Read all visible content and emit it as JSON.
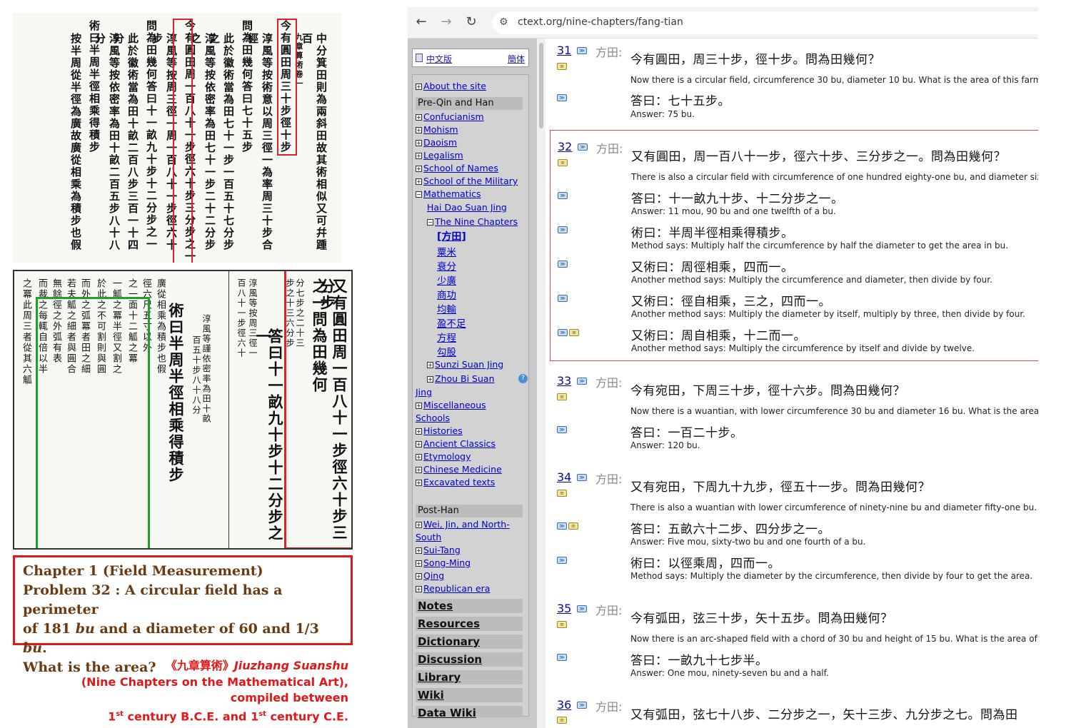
{
  "scan": {
    "top_columns": [
      "中分箕田則為兩斜田故其術相似又可幷踵百",
      "九章算術卷一",
      "今有圓田周三十步徑十步",
      "淳風等按術意以周三徑一為率周三十步合徑",
      "問為田幾何答曰七十五步",
      "此於徽術當為田七十一步一百五十七分步之",
      "淳風等按依密率為田七十一步二十二分步之",
      "今有圓田周一百八十一步徑六十步三分步之一",
      "淳風等按周三徑一周一百八十一步徑六十步",
      "問為田幾何答曰十一畝九十步十二分步之一",
      "此於徽術當為田十畝二百八步三百一十四分",
      "淳風等按依密率為田十畝二百五步八十八分",
      "術曰半周半徑相乘得積步",
      "按半周從半徑為廣故廣從相乘為積步也假"
    ],
    "bottom_columns_right": [
      "又有圓田周一百八十一步徑六十步三分步",
      "之一問為田幾何",
      "答曰十一畝九十步十二分步之一",
      "分七步之二十三",
      "步之十三六分步",
      "淳風等按周三徑一",
      "百八十一步徑六十"
    ],
    "bottom_columns_left": [
      "術曰半周半徑相乘得積步",
      "淳風等謹依密率為田十畝",
      "百五十步八十八分",
      "廣從相乘為積步也假",
      "徑六尺五寸以外",
      "之一面十二觚之冪",
      "一觚之冪半徑又割之",
      "於此之不可割則與圓",
      "而外之弧冪者田之細",
      "若夫觚之細者與圓合",
      "無餘徑之外弧有表",
      "而裁之每輒自倍以半",
      "之冪此周三者從其六觚"
    ],
    "problem_box": {
      "line1": "Chapter 1 (Field Measurement)",
      "line2": "Problem 32 : A circular field has a perimeter",
      "line3a": "of 181 ",
      "line3_unit1": "bu",
      "line3b": " and a diameter of 60 and 1/3 ",
      "line3_unit2": "bu",
      "line3c": ".",
      "line4": "What is the area?"
    },
    "credit": {
      "line1a": "《九章算術》",
      "line1b": "Jiuzhang Suanshu",
      "line2": "(Nine Chapters on the Mathematical Art),",
      "line3": "compiled between",
      "line4a": "1",
      "line4_sup1": "st",
      "line4b": " century B.C.E. and 1",
      "line4_sup2": "st",
      "line4c": " century C.E."
    },
    "colors": {
      "red": "#e01818",
      "green": "#1ea02a",
      "problem_text": "#6b3a10"
    }
  },
  "browser": {
    "back_icon": "←",
    "forward_icon": "→",
    "reload_icon": "↻",
    "url": "ctext.org/nine-chapters/fang-tian",
    "sidebar": {
      "lang_zh": "中文版",
      "lang_simplified": "簡体",
      "about": "About the site",
      "preqin_header": "Pre-Qin and Han",
      "confucianism": "Confucianism",
      "mohism": "Mohism",
      "daoism": "Daoism",
      "legalism": "Legalism",
      "names": "School of Names",
      "military": "School of the Military",
      "mathematics": "Mathematics",
      "haidao": "Hai Dao Suan Jing",
      "nine_chapters": "The Nine Chapters",
      "fangtian": "[方田]",
      "sumi": "粟米",
      "cuifen": "衰分",
      "shaoguang": "少廣",
      "shanggong": "商功",
      "junshu": "均輸",
      "yingbuzu": "盈不足",
      "fangcheng": "方程",
      "gougu": "勾股",
      "sunzi": "Sunzi Suan Jing",
      "zhoubi_a": "Zhou Bi Suan",
      "zhoubi_b": "Jing",
      "misc_a": "Miscellaneous",
      "misc_b": "Schools",
      "histories": "Histories",
      "ancient": "Ancient Classics",
      "etymology": "Etymology",
      "medicine": "Chinese Medicine",
      "excavated": "Excavated texts",
      "posthan_header": "Post-Han",
      "wei_a": "Wei, Jin, and North-",
      "wei_b": "South",
      "suitang": "Sui-Tang",
      "songming": "Song-Ming",
      "qing": "Qing",
      "republican": "Republican era",
      "notes": "Notes",
      "resources": "Resources",
      "dictionary": "Dictionary",
      "discussion": "Discussion",
      "library": "Library",
      "wiki": "Wiki",
      "datawiki": "Data Wiki"
    },
    "entries": [
      {
        "num": "31",
        "cat": "方田:",
        "zh1": "今有圓田，周三十步，徑十步。問為田幾何？",
        "en1": "Now there is a circular field, circumference 30 bu, diameter 10 bu. What is the area of this farm?",
        "zh2": "答曰：七十五步。",
        "en2": "Answer: 75 bu."
      },
      {
        "num": "32",
        "cat": "方田:",
        "zh1": "又有圓田，周一百八十一步，徑六十步、三分步之一。問為田幾何？",
        "en1": "There is also a circular field with circumference of one hundred eighty-one bu, and diameter sixty",
        "zh2": "答曰：十一畝九十步、十二分步之一。",
        "en2": "Answer: 11 mou, 90 bu and one twelfth of a bu.",
        "zh3": "術曰：半周半徑相乘得積步。",
        "en3": "Method says: Multiply half the circumference by half the diameter to get the area in bu.",
        "zh4": "又術曰：周徑相乘，四而一。",
        "en4": "Another method says: Multiply the circumference and diameter, then divide by four.",
        "zh5": "又術曰：徑自相乘，三之，四而一。",
        "en5": "Another method says: Multiply the diameter by itself, multiply by three, then divide by four.",
        "zh6": "又術曰：周自相乘，十二而一。",
        "en6": "Another method says: Multiply the circumference by itself and divide by twelve."
      },
      {
        "num": "33",
        "cat": "方田:",
        "zh1": "今有宛田，下周三十步，徑十六步。問為田幾何？",
        "en1": "Now there is a wuantian, with lower circumference 30 bu and diameter 16 bu. What is the area of",
        "zh2": "答曰：一百二十步。",
        "en2": "Answer: 120 bu."
      },
      {
        "num": "34",
        "cat": "方田:",
        "zh1": "又有宛田，下周九十九步，徑五十一步。問為田幾何？",
        "en1": "There is also a wuantian with lower circumference of ninety-nine bu and diameter fifty-one bu. Wh",
        "zh2": "答曰：五畝六十二步、四分步之一。",
        "en2": "Answer: Five mou, sixty-two bu and one fourth of a bu.",
        "zh3": "術曰：以徑乘周，四而一。",
        "en3": "Method says: Multiply the diameter by the circumference, then divide by four to get the area."
      },
      {
        "num": "35",
        "cat": "方田:",
        "zh1": "今有弧田，弦三十步，矢十五步。問為田幾何？",
        "en1": "Now there is an arc-shaped field with a chord of 30 bu and height of 15 bu. What is the area of th",
        "zh2": "答曰：一畝九十七步半。",
        "en2": "Answer: One mou, ninety-seven bu and a half."
      },
      {
        "num": "36",
        "cat": "方田:",
        "zh1": "又有弧田，弦七十八步、二分步之一，矢十三步、九分步之七。問為田"
      }
    ]
  }
}
